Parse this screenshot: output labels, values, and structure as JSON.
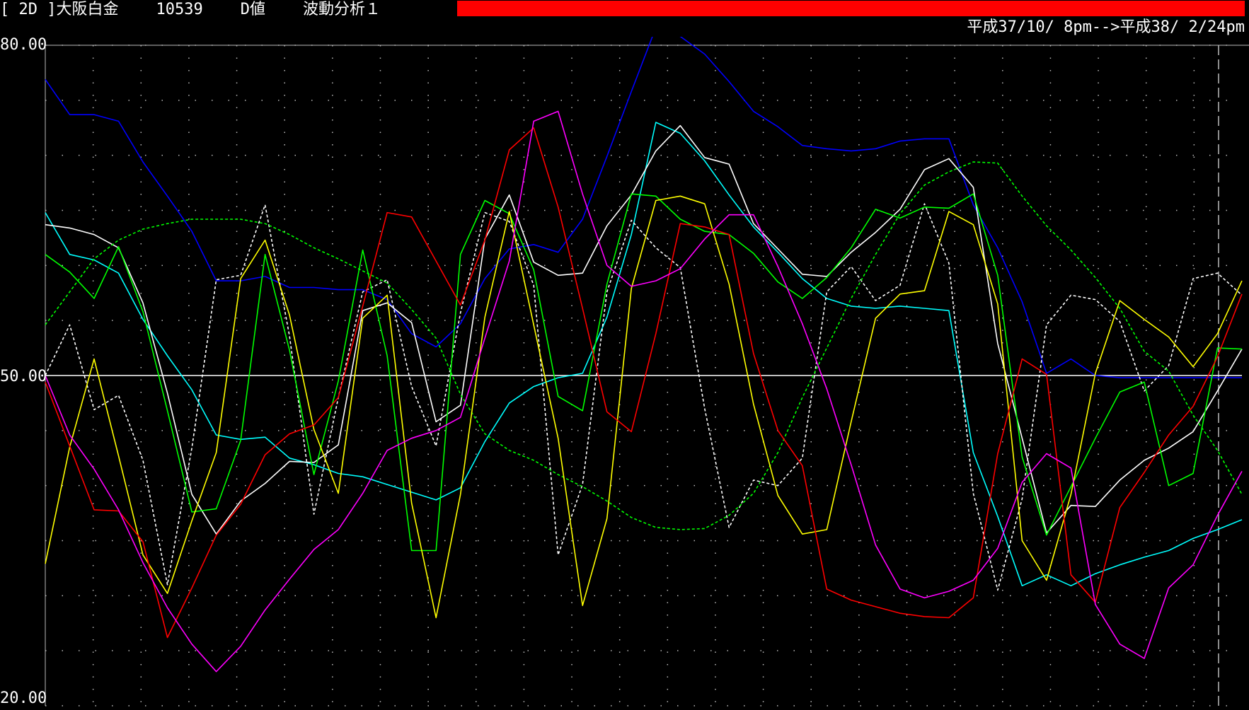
{
  "header": {
    "bracket_code": "[ 2D ]",
    "instrument": "大阪白金",
    "code": "10539",
    "value_type": "D値",
    "analysis": "波動分析１",
    "date_range": "平成37/10/ 8pm-->平成38/ 2/24pm",
    "status_bar_color": "#ff0000"
  },
  "colors": {
    "background": "#000000",
    "grid": "#bbbbbb",
    "midline": "#ffffff"
  },
  "chart_data": {
    "type": "line",
    "ylim": [
      20,
      80
    ],
    "yticks": [
      "80.00",
      "50.00",
      "20.00"
    ],
    "midline_value": 50,
    "x_count": 50,
    "series": [
      {
        "color": "#0000ff",
        "style": "solid",
        "values": [
          76.9,
          73.7,
          73.7,
          73.1,
          69.4,
          66.3,
          63.1,
          58.6,
          58.6,
          59.0,
          58.0,
          58.0,
          57.8,
          57.8,
          56.9,
          53.8,
          52.6,
          54.7,
          58.8,
          61.5,
          61.9,
          61.2,
          64.2,
          69.9,
          75.8,
          81.6,
          80.8,
          79.2,
          76.7,
          74.0,
          72.6,
          70.9,
          70.6,
          70.4,
          70.6,
          71.3,
          71.5,
          71.5,
          65.5,
          61.6,
          56.7,
          50.2,
          51.5,
          50.0,
          49.8,
          49.8,
          49.8,
          49.8,
          49.8,
          49.8
        ]
      },
      {
        "color": "#00ffff",
        "style": "solid",
        "values": [
          64.8,
          61.0,
          60.5,
          59.3,
          55.1,
          51.8,
          48.7,
          44.6,
          44.2,
          44.4,
          42.5,
          41.9,
          41.1,
          40.8,
          40.1,
          39.4,
          38.7,
          39.8,
          44.0,
          47.5,
          49.0,
          49.8,
          50.2,
          55.3,
          62.8,
          73.0,
          72.0,
          69.5,
          66.4,
          63.5,
          61.2,
          58.8,
          57.0,
          56.3,
          56.1,
          56.3,
          56.1,
          55.9,
          43.0,
          37.2,
          30.9,
          31.9,
          30.9,
          32.0,
          32.8,
          33.5,
          34.1,
          35.2,
          36.0,
          36.9
        ]
      },
      {
        "color": "#ffffff",
        "style": "solid",
        "values": [
          63.7,
          63.4,
          62.8,
          61.6,
          56.6,
          48.4,
          39.2,
          35.6,
          38.6,
          40.2,
          42.2,
          42.1,
          43.7,
          55.9,
          56.6,
          54.8,
          45.8,
          47.3,
          62.4,
          66.4,
          60.3,
          59.1,
          59.3,
          63.6,
          66.4,
          70.4,
          72.7,
          69.8,
          69.2,
          63.8,
          61.5,
          59.2,
          59.0,
          61.2,
          63.0,
          65.1,
          68.7,
          69.7,
          67.1,
          52.9,
          44.3,
          35.7,
          38.2,
          38.1,
          40.5,
          42.3,
          43.4,
          44.9,
          48.6,
          52.4
        ]
      },
      {
        "color": "#ffffff",
        "style": "dashed",
        "values": [
          50.0,
          54.6,
          46.9,
          48.2,
          42.3,
          31.0,
          43.4,
          58.7,
          59.1,
          65.5,
          53.6,
          37.4,
          48.0,
          57.6,
          58.7,
          49.0,
          43.6,
          55.7,
          64.8,
          64.0,
          58.2,
          33.7,
          40.1,
          57.6,
          64.1,
          61.6,
          59.8,
          47.0,
          36.2,
          40.5,
          40.0,
          42.5,
          57.6,
          59.9,
          56.8,
          58.2,
          65.6,
          60.2,
          39.3,
          30.5,
          38.8,
          54.6,
          57.3,
          56.9,
          54.9,
          48.6,
          50.9,
          58.8,
          59.3,
          57.3
        ]
      },
      {
        "color": "#00ff00",
        "style": "dashed",
        "values": [
          54.6,
          57.6,
          60.6,
          62.3,
          63.3,
          63.8,
          64.2,
          64.2,
          64.2,
          63.8,
          62.8,
          61.6,
          60.6,
          59.5,
          58.4,
          56.0,
          53.4,
          48.3,
          44.7,
          43.2,
          42.3,
          41.0,
          39.9,
          38.6,
          37.1,
          36.2,
          36.0,
          36.1,
          37.3,
          39.3,
          43.0,
          48.0,
          52.5,
          57.0,
          61.0,
          64.7,
          67.3,
          68.5,
          69.4,
          69.3,
          66.3,
          63.6,
          61.4,
          58.9,
          56.1,
          52.2,
          50.4,
          46.4,
          43.2,
          39.2
        ]
      },
      {
        "color": "#00ff00",
        "style": "solid",
        "values": [
          61.0,
          59.4,
          57.0,
          61.7,
          55.8,
          46.8,
          37.6,
          37.9,
          44.1,
          61.0,
          52.3,
          41.0,
          49.5,
          61.4,
          51.8,
          34.1,
          34.1,
          61.0,
          65.9,
          64.7,
          59.6,
          48.1,
          46.8,
          58.3,
          66.5,
          66.3,
          64.2,
          63.1,
          62.8,
          61.1,
          58.5,
          57.0,
          58.9,
          61.6,
          65.1,
          64.3,
          65.3,
          65.2,
          66.5,
          59.1,
          42.6,
          35.5,
          39.9,
          44.3,
          48.5,
          49.4,
          40.0,
          41.1,
          52.5,
          52.4
        ]
      },
      {
        "color": "#ffff00",
        "style": "solid",
        "values": [
          32.9,
          43.5,
          51.5,
          42.7,
          33.7,
          30.2,
          36.8,
          43.0,
          58.8,
          62.3,
          55.5,
          45.1,
          39.3,
          55.2,
          57.3,
          38.4,
          28.0,
          39.2,
          55.3,
          64.9,
          54.6,
          44.3,
          29.1,
          37.0,
          57.9,
          65.9,
          66.3,
          65.6,
          58.3,
          47.4,
          39.1,
          35.6,
          36.0,
          45.8,
          55.2,
          57.4,
          57.7,
          64.9,
          63.7,
          56.5,
          35.0,
          31.4,
          39.2,
          50.2,
          56.8,
          55.1,
          53.5,
          50.8,
          53.8,
          58.6
        ]
      },
      {
        "color": "#ff0000",
        "style": "solid",
        "values": [
          49.4,
          43.6,
          37.8,
          37.7,
          34.9,
          26.2,
          30.7,
          35.5,
          38.3,
          42.8,
          44.7,
          45.5,
          48.0,
          56.3,
          64.8,
          64.4,
          60.4,
          56.4,
          62.3,
          70.5,
          72.5,
          65.3,
          56.1,
          46.7,
          44.9,
          53.8,
          63.8,
          63.5,
          62.8,
          52.0,
          45.0,
          41.8,
          30.6,
          29.6,
          29.0,
          28.4,
          28.1,
          28.0,
          29.8,
          42.9,
          51.5,
          50.1,
          31.9,
          29.4,
          38.0,
          41.2,
          44.6,
          47.2,
          51.7,
          57.4
        ]
      },
      {
        "color": "#ff00ff",
        "style": "solid",
        "values": [
          50.0,
          44.6,
          41.5,
          37.8,
          33.0,
          28.9,
          25.6,
          23.1,
          25.4,
          28.7,
          31.5,
          34.2,
          36.0,
          39.3,
          43.2,
          44.3,
          45.0,
          46.2,
          53.4,
          60.4,
          73.1,
          74.0,
          66.5,
          60.0,
          58.1,
          58.6,
          59.7,
          62.4,
          64.6,
          64.6,
          59.9,
          54.7,
          48.8,
          41.9,
          34.6,
          30.6,
          29.8,
          30.4,
          31.4,
          34.3,
          40.3,
          42.9,
          41.6,
          29.2,
          25.6,
          24.3,
          30.7,
          32.8,
          37.3,
          41.3
        ]
      }
    ]
  }
}
